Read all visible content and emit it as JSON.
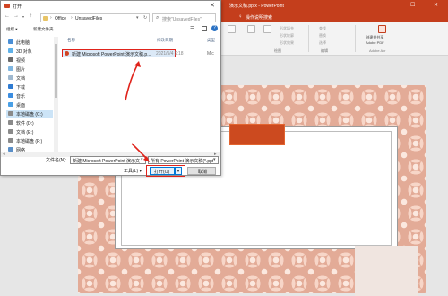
{
  "powerpoint": {
    "window_title": "演示文稿.pptx - PowerPoint",
    "tabs": [
      "操作说明搜索"
    ],
    "ribbon": {
      "small_labels": [
        "形状填充",
        "形状轮廓",
        "形状效果",
        "查找",
        "替换",
        "选择"
      ],
      "group_labels": [
        "绘图",
        "编辑",
        "Adobe Acr"
      ],
      "adobe_button": "创建并共享\nAdobe PDF"
    }
  },
  "dialog": {
    "title": "打开",
    "close_glyph": "✕",
    "path": [
      "Office",
      "UnsavedFiles"
    ],
    "search_placeholder": "搜索\"UnsavedFiles\"",
    "commands": {
      "organize": "组织 ▾",
      "new_folder": "新建文件夹"
    },
    "columns": {
      "name": "名称",
      "modified": "修改日期",
      "type": "类型"
    },
    "nav_items": [
      {
        "label": "此电脑",
        "icon": "computer-icon"
      },
      {
        "label": "3D 对象",
        "icon": "cube-icon"
      },
      {
        "label": "视频",
        "icon": "video-icon"
      },
      {
        "label": "图片",
        "icon": "picture-icon"
      },
      {
        "label": "文档",
        "icon": "document-icon"
      },
      {
        "label": "下载",
        "icon": "download-icon"
      },
      {
        "label": "音乐",
        "icon": "music-icon"
      },
      {
        "label": "桌面",
        "icon": "desktop-icon"
      },
      {
        "label": "本地磁盘 (C:)",
        "icon": "drive-icon",
        "selected": true
      },
      {
        "label": "软件 (D:)",
        "icon": "drive-icon"
      },
      {
        "label": "文档 (E:)",
        "icon": "drive-icon"
      },
      {
        "label": "本地磁盘 (F:)",
        "icon": "drive-icon"
      },
      {
        "label": "网络",
        "icon": "network-icon"
      }
    ],
    "files": [
      {
        "name": "新建 Microsoft PowerPoint 演示文稿.p...",
        "modified": "2021/5/4 9:18",
        "type": "Mic"
      }
    ],
    "filename_label": "文件名(N):",
    "filename_value": "新建 Microsoft PowerPoint 演示文稿.p",
    "filetype_value": "所有 PowerPoint 演示文稿(*.pptx;",
    "tools_label": "工具(L) ▾",
    "open_button": "打开(O)",
    "cancel_button": "取消"
  },
  "colors": {
    "ppt_accent": "#c43e1c",
    "highlight": "#e0231b",
    "selection": "#cce4f7"
  }
}
